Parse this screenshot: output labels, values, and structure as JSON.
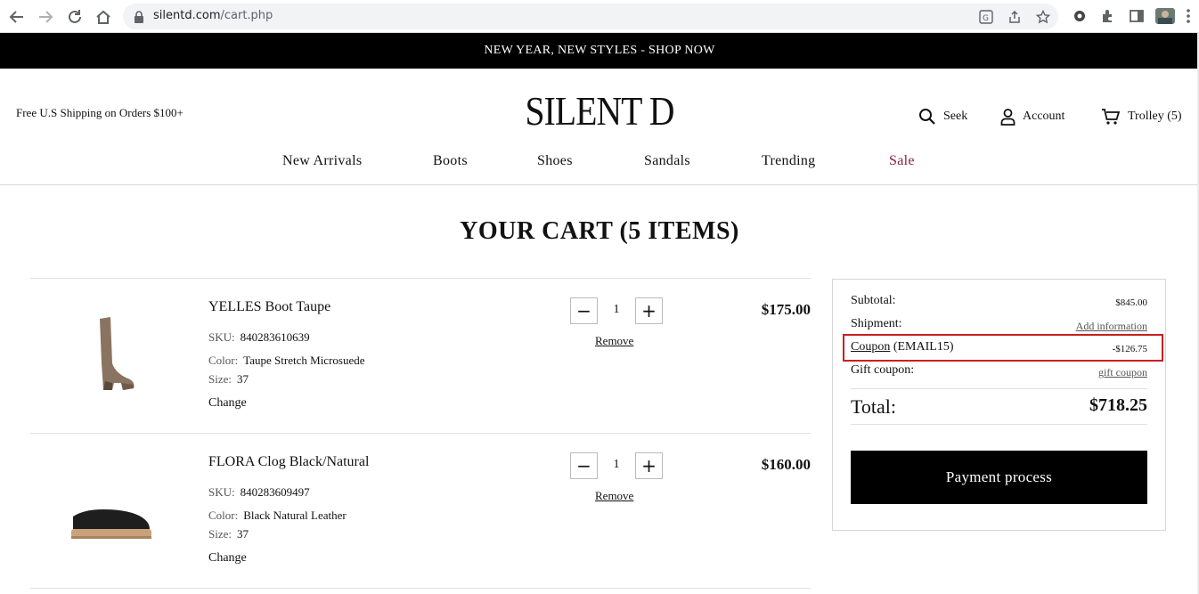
{
  "browser": {
    "url_host": "silentd.com",
    "url_path": "/cart.php"
  },
  "promo": {
    "text": "NEW YEAR, NEW STYLES - SHOP NOW"
  },
  "header": {
    "shipping_note": "Free U.S Shipping on Orders $100+",
    "logo": "SILENT D",
    "search_label": "Seek",
    "account_label": "Account",
    "cart_label": "Trolley (5)"
  },
  "menu": {
    "items": [
      "New Arrivals",
      "Boots",
      "Shoes",
      "Sandals",
      "Trending",
      "Sale"
    ]
  },
  "cart": {
    "title": "YOUR CART (5 ITEMS)",
    "sku_key": "SKU:",
    "color_key": "Color:",
    "size_key": "Size:",
    "change_label": "Change",
    "remove_label": "Remove",
    "items": [
      {
        "name": "YELLES Boot Taupe",
        "sku": "840283610639",
        "color": "Taupe Stretch Microsuede",
        "size": "37",
        "quantity": "1",
        "price": "$175.00"
      },
      {
        "name": "FLORA Clog Black/Natural",
        "sku": "840283609497",
        "color": "Black Natural Leather",
        "size": "37",
        "quantity": "1",
        "price": "$160.00"
      }
    ]
  },
  "summary": {
    "subtotal_label": "Subtotal:",
    "subtotal_value": "$845.00",
    "shipment_label": "Shipment:",
    "shipment_link": "Add information",
    "coupon_label": "Coupon",
    "coupon_code": "(EMAIL15)",
    "coupon_value": "-$126.75",
    "gift_label": "Gift coupon:",
    "gift_link": "gift coupon",
    "total_label": "Total:",
    "total_value": "$718.25",
    "pay_button": "Payment process"
  },
  "colors": {
    "sale": "#8b1e3f",
    "highlight": "#cc1f1f",
    "promo_bg": "#000000"
  },
  "icons": [
    "back-icon",
    "forward-icon",
    "reload-icon",
    "home-icon",
    "lock-icon",
    "translate-icon",
    "share-icon",
    "star-icon",
    "extensions-icon",
    "sidebar-icon",
    "profile-icon",
    "menu-icon",
    "search-icon",
    "account-icon",
    "cart-icon"
  ]
}
